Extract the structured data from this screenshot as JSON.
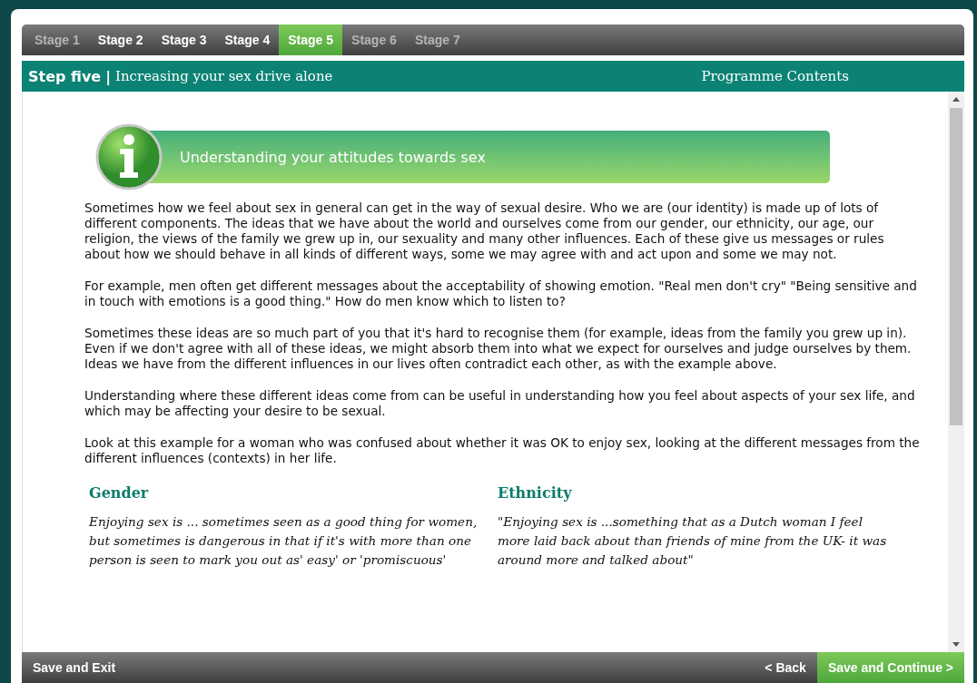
{
  "stages": [
    {
      "label": "Stage 1",
      "selected": false,
      "disabled": true
    },
    {
      "label": "Stage 2",
      "selected": false,
      "disabled": false
    },
    {
      "label": "Stage 3",
      "selected": false,
      "disabled": false
    },
    {
      "label": "Stage 4",
      "selected": false,
      "disabled": false
    },
    {
      "label": "Stage 5",
      "selected": true,
      "disabled": false
    },
    {
      "label": "Stage 6",
      "selected": false,
      "disabled": true
    },
    {
      "label": "Stage 7",
      "selected": false,
      "disabled": true
    }
  ],
  "header": {
    "step": "Step five",
    "separator": "|",
    "title": "Increasing your sex drive alone",
    "contents_link": "Programme Contents"
  },
  "banner": {
    "title": "Understanding your attitudes towards sex"
  },
  "paragraphs": [
    "Sometimes how we feel about sex in general can get in the way of sexual desire. Who we are (our identity) is made up of lots of different components. The ideas that we have about the world and ourselves come from our gender, our ethnicity, our age, our religion, the views of the family we grew up in, our sexuality and many other influences. Each of these give us messages or rules about how we should behave in all kinds of different ways, some we may agree with and act upon and some we may not.",
    "For example, men often get different messages about the acceptability of showing emotion. \"Real men don't cry\" \"Being sensitive and in touch with emotions is a good thing.\" How do men know which to listen to?",
    "Sometimes these ideas are so much part of you that it's hard to recognise them (for example, ideas from the family you grew up in). Even if we don't agree with all of these ideas, we might absorb them into what we expect for ourselves and judge ourselves by them. Ideas we have from the different influences in our lives often contradict each other, as with the example above.",
    "Understanding where these different ideas come from can be useful in understanding how you feel about aspects of your sex life, and which may be affecting your desire to be sexual.",
    "Look at this example for a woman who was confused about whether it was OK to enjoy sex, looking at the different messages from the different influences (contexts) in her life."
  ],
  "influences": [
    {
      "heading": "Gender",
      "text": "Enjoying sex is ... sometimes seen as a good thing for women, but sometimes is dangerous in that if it's with more than one person is seen to mark you out as' easy' or 'promiscuous'"
    },
    {
      "heading": "Ethnicity",
      "text": "\"Enjoying sex is ...something that as a Dutch woman I feel more laid back about than friends of mine from the UK- it was around more and talked about\""
    }
  ],
  "footer": {
    "exit": "Save and Exit",
    "back": "< Back",
    "continue": "Save and Continue >"
  }
}
